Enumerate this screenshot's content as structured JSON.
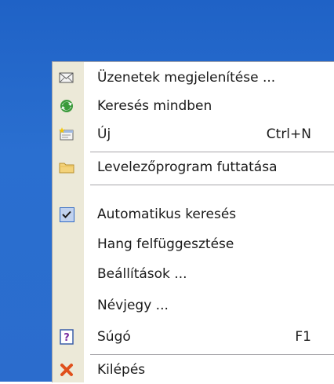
{
  "menu": {
    "items": [
      {
        "label": "Üzenetek megjelenítése ...",
        "shortcut": "",
        "icon": "envelope-icon"
      },
      {
        "label": "Keresés mindben",
        "shortcut": "",
        "icon": "refresh-arrows-icon"
      },
      {
        "label": "Új",
        "shortcut": "Ctrl+N",
        "icon": "new-message-icon"
      },
      {
        "label": "Levelezőprogram futtatása",
        "shortcut": "",
        "icon": "folder-icon"
      },
      {
        "label": "Automatikus keresés",
        "shortcut": "",
        "icon": "checkmark-icon",
        "checked": true
      },
      {
        "label": "Hang felfüggesztése",
        "shortcut": ""
      },
      {
        "label": "Beállítások ...",
        "shortcut": ""
      },
      {
        "label": "Névjegy ...",
        "shortcut": ""
      },
      {
        "label": "Súgó",
        "shortcut": "F1",
        "icon": "help-icon"
      },
      {
        "label": "Kilépés",
        "shortcut": "",
        "icon": "close-x-icon"
      }
    ]
  },
  "colors": {
    "desktop": "#2a6fd0",
    "menu_bg": "#ffffff",
    "gutter": "#ece9d8",
    "separator": "#a7a6aa",
    "exit_icon": "#e0501c"
  }
}
